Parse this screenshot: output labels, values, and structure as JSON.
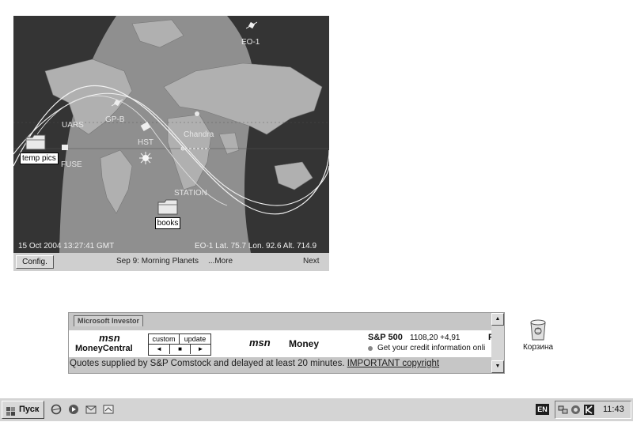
{
  "tracker": {
    "timestamp": "15 Oct 2004 13:27:41 GMT",
    "readout": "EO-1 Lat. 75.7 Lon. 92.6 Alt. 714.9",
    "satellites": [
      "EO-1",
      "UARS",
      "GP-B",
      "HST",
      "Chandra",
      "STATION",
      "FUSE"
    ],
    "desktop_folders": [
      "temp pics",
      "books"
    ],
    "config_label": "Config.",
    "ticker_text": "Sep 9: Morning Planets",
    "more_label": "...More",
    "next_label": "Next"
  },
  "investor": {
    "tab_label": "Microsoft Investor",
    "msn_logo_1": "msn",
    "moneycentral_label": "MoneyCentral",
    "custom_label": "custom",
    "update_label": "update",
    "nav_prev": "◄",
    "nav_stop": "■",
    "nav_next": "►",
    "msn_logo_2": "msn",
    "money_label": "Money",
    "sp_label": "S&P 500",
    "sp_value": "1108,20 +4,91",
    "sp_trailing": "F",
    "credit_text": "Get your credit information onli",
    "quote_text": "Quotes supplied by S&P Comstock and delayed at least 20 minutes. ",
    "quote_link": "IMPORTANT copyright"
  },
  "desktop": {
    "recycle_label": "Корзина"
  },
  "taskbar": {
    "start_label": "Пуск",
    "language": "EN",
    "clock": "11:43"
  }
}
